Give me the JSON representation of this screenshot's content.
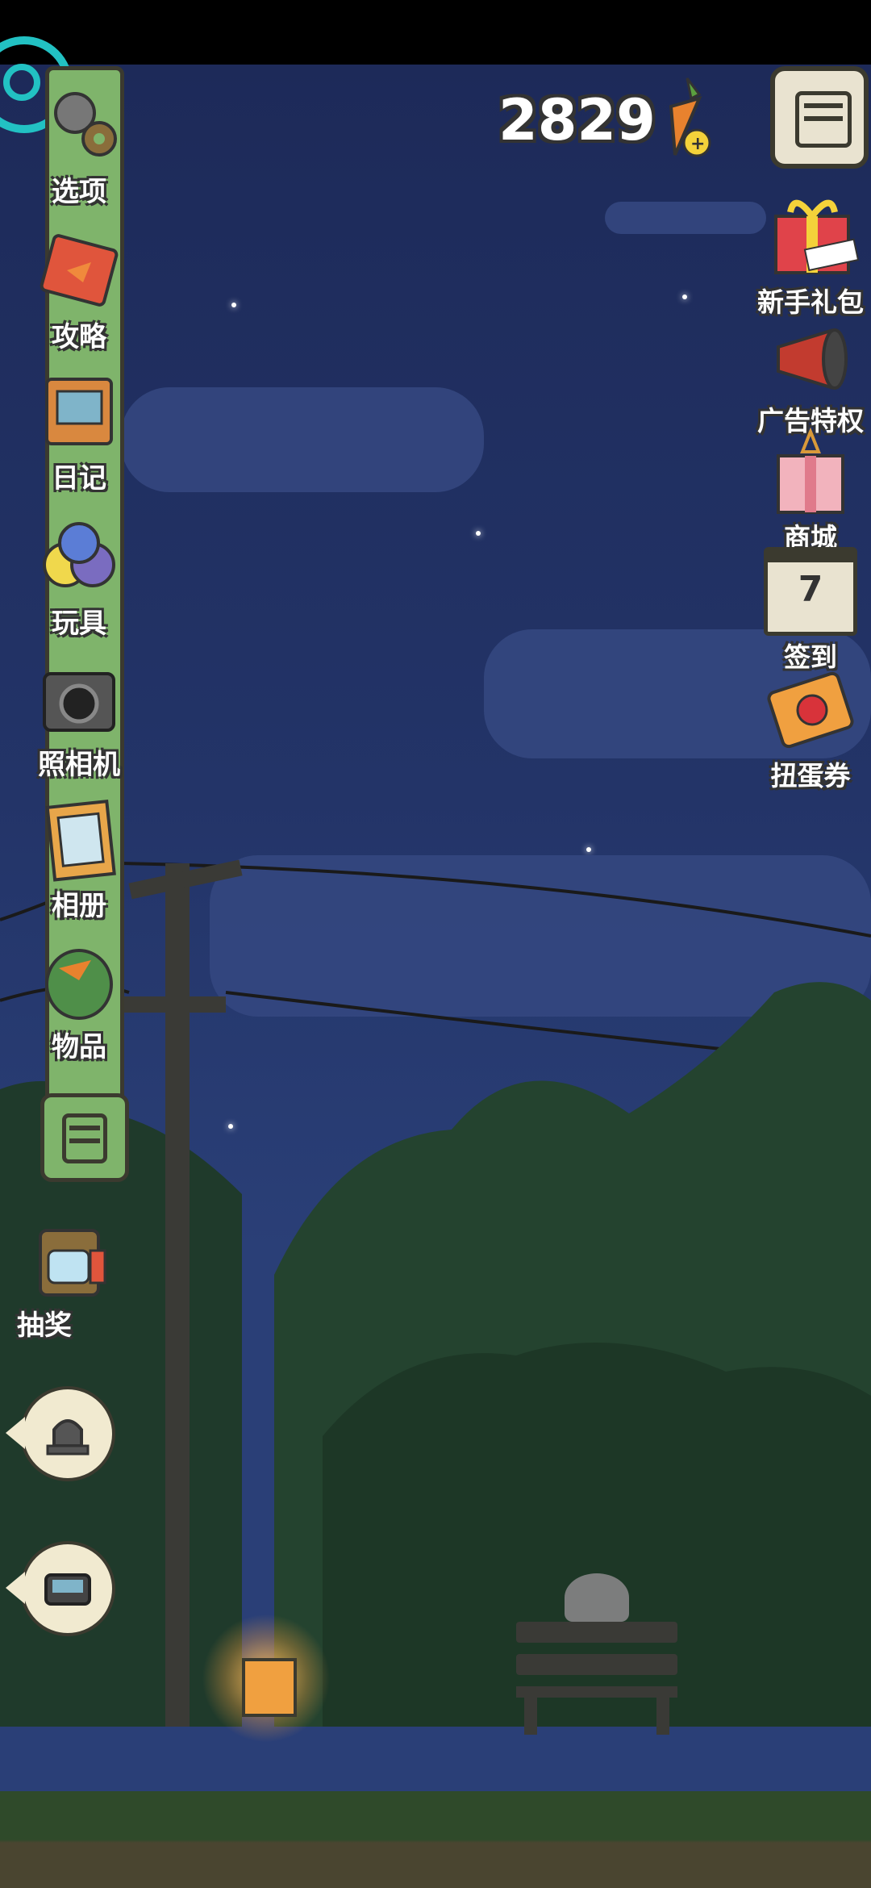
{
  "hud": {
    "score": "2829"
  },
  "sidebar": {
    "items": [
      {
        "label": "选项",
        "icon": "gear-icon"
      },
      {
        "label": "攻略",
        "icon": "guide-book-icon"
      },
      {
        "label": "日记",
        "icon": "diary-icon"
      },
      {
        "label": "玩具",
        "icon": "toy-balls-icon"
      },
      {
        "label": "照相机",
        "icon": "camera-icon"
      },
      {
        "label": "相册",
        "icon": "photo-album-icon"
      },
      {
        "label": "物品",
        "icon": "backpack-icon"
      }
    ]
  },
  "lottery": {
    "label": "抽奖",
    "icon": "lottery-machine-icon"
  },
  "right_menu": {
    "newbie_gift": {
      "label": "新手礼包",
      "badge": "新手礼包"
    },
    "ad_privilege": {
      "label": "广告特权"
    },
    "shop": {
      "label": "商城"
    },
    "checkin": {
      "label": "签到",
      "day": "7"
    },
    "gacha_ticket": {
      "label": "扭蛋券"
    }
  },
  "colors": {
    "sky": "#233468",
    "sidebar_green": "#7fb46b",
    "outline": "#3b3a2f",
    "lantern": "#f0a040"
  }
}
